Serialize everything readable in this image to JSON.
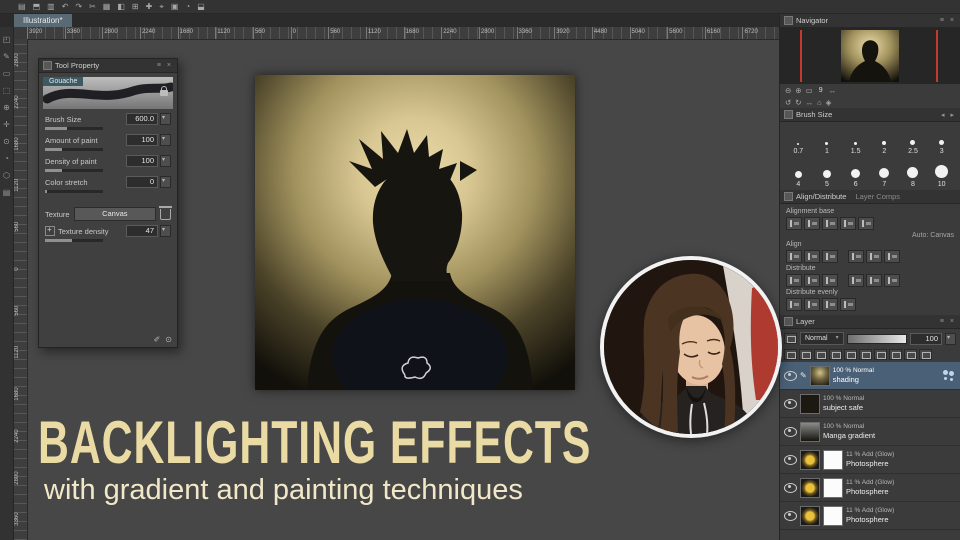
{
  "window": {
    "doc_tab": "Illustration*"
  },
  "topbar_icons": [
    "▤",
    "⬒",
    "▥",
    "↶",
    "↷",
    "✂",
    "▦",
    "◧",
    "⊞",
    "✚",
    "⌖",
    "▣",
    "◔",
    "⬓"
  ],
  "left_toolbar_icons": [
    "◰",
    "✎",
    "▭",
    "⬚",
    "⊕",
    "✛",
    "⊙",
    "◔",
    "⬡",
    "▤"
  ],
  "ruler_top": [
    "3920",
    "3360",
    "2800",
    "2240",
    "1680",
    "1120",
    "560",
    "0",
    "560",
    "1120",
    "1680",
    "2240",
    "2800",
    "3360",
    "3920",
    "4480",
    "5040",
    "5600",
    "6160",
    "6720"
  ],
  "ruler_left": [
    "2800",
    "2240",
    "1680",
    "1120",
    "560",
    "0",
    "560",
    "1120",
    "1680",
    "2240",
    "2800",
    "3360"
  ],
  "tool_property": {
    "title": "Tool Property",
    "tool_name": "Gouache",
    "fields": [
      {
        "label": "Brush Size",
        "value": "600.0"
      },
      {
        "label": "Amount of paint",
        "value": "100"
      },
      {
        "label": "Density of paint",
        "value": "100"
      },
      {
        "label": "Color stretch",
        "value": "0"
      }
    ],
    "texture_label": "Texture",
    "texture_value": "Canvas",
    "texture_density_label": "Texture density",
    "texture_density_value": "47",
    "foot_icons": [
      "✐",
      "⊙"
    ]
  },
  "navigator": {
    "title": "Navigator",
    "zoom_text": "9",
    "icons_row1": [
      "⊖",
      "⊕",
      "▭",
      "↔"
    ],
    "icons_row2": [
      "↺",
      "↻",
      "↔",
      "⌂",
      "◈"
    ]
  },
  "brush_size_panel": {
    "title": "Brush Size",
    "presets": [
      {
        "label": "0.7"
      },
      {
        "label": "1"
      },
      {
        "label": "1.5"
      },
      {
        "label": "2"
      },
      {
        "label": "2.5"
      },
      {
        "label": "3"
      },
      {
        "label": "4"
      },
      {
        "label": "5"
      },
      {
        "label": "6"
      },
      {
        "label": "7"
      },
      {
        "label": "8"
      },
      {
        "label": "10"
      }
    ]
  },
  "align_panel": {
    "title": "Align/Distribute",
    "tab2": "Layer Comps",
    "alignment_base_label": "Alignment base",
    "auto_value": "Auto: Canvas",
    "align_label": "Align",
    "distribute_label": "Distribute",
    "distribute_evenly_label": "Distribute evenly"
  },
  "layer_panel": {
    "title": "Layer",
    "blend_mode": "Normal",
    "opacity_value": "100",
    "layers": [
      {
        "mode": "100 % Normal",
        "name": "shading"
      },
      {
        "mode": "100 % Normal",
        "name": "subject safe"
      },
      {
        "mode": "100 % Normal",
        "name": "Manga gradient"
      },
      {
        "mode": "11 % Add (Glow)",
        "name": "Photosphere"
      },
      {
        "mode": "11 % Add (Glow)",
        "name": "Photosphere"
      },
      {
        "mode": "11 % Add (Glow)",
        "name": "Photosphere"
      }
    ]
  },
  "overlay": {
    "title": "BACKLIGHTING EFFECTS",
    "subtitle": "with gradient and painting techniques",
    "title_color": "#eadba4",
    "subtitle_color": "#f2e8c8"
  }
}
